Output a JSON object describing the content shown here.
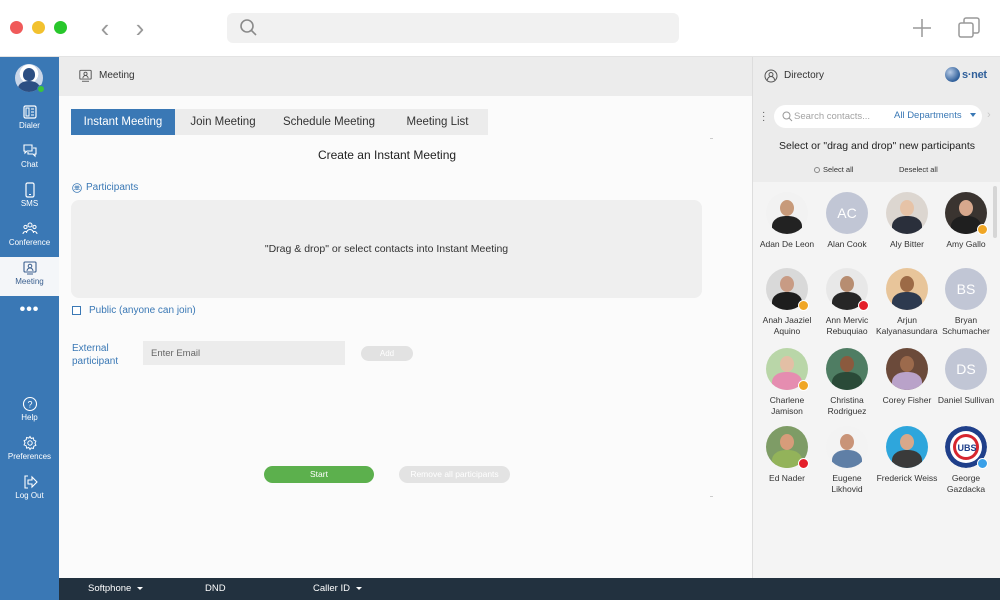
{
  "window": {
    "back_icon": "chevron-left-icon",
    "forward_icon": "chevron-right-icon",
    "search_icon": "search-icon",
    "new_tab_icon": "plus-icon",
    "tabs_icon": "copy-windows-icon"
  },
  "sidebar": {
    "user_status": "online",
    "items": [
      {
        "label": "Dialer",
        "icon": "dialer-icon"
      },
      {
        "label": "Chat",
        "icon": "chat-icon"
      },
      {
        "label": "SMS",
        "icon": "phone-icon"
      },
      {
        "label": "Conference",
        "icon": "conference-icon"
      },
      {
        "label": "Meeting",
        "icon": "meeting-icon",
        "active": true
      }
    ],
    "more_label": "•••",
    "bottom_items": [
      {
        "label": "Help",
        "icon": "help-icon"
      },
      {
        "label": "Preferences",
        "icon": "gear-icon"
      },
      {
        "label": "Log Out",
        "icon": "logout-icon"
      }
    ]
  },
  "meeting": {
    "header_title": "Meeting",
    "tabs": [
      {
        "label": "Instant Meeting",
        "active": true
      },
      {
        "label": "Join Meeting"
      },
      {
        "label": "Schedule Meeting"
      },
      {
        "label": "Meeting List"
      }
    ],
    "section_title": "Create an Instant Meeting",
    "participants_label": "Participants",
    "dropzone_text": "\"Drag & drop\" or select contacts into Instant Meeting",
    "public_label": "Public (anyone can join)",
    "public_checked": false,
    "external_label_line1": "External",
    "external_label_line2": "participant",
    "email_placeholder": "Enter Email",
    "email_value": "",
    "add_label": "Add",
    "start_label": "Start",
    "remove_all_label": "Remove all participants"
  },
  "directory": {
    "header_title": "Directory",
    "logo_text": "s·net",
    "search_placeholder": "Search contacts...",
    "department": "All Departments",
    "prompt": "Select or \"drag and drop\" new participants",
    "select_all": "Select all",
    "deselect_all": "Deselect all",
    "contacts": [
      {
        "name": "Adan De Leon",
        "initials": "",
        "status": "",
        "bg": "#f2f2f2",
        "skin": "#c79a7a",
        "cloth": "#222222"
      },
      {
        "name": "Alan Cook",
        "initials": "AC",
        "status": ""
      },
      {
        "name": "Aly Bitter",
        "initials": "",
        "status": "",
        "bg": "#dcd6d0",
        "skin": "#e6c3a7",
        "cloth": "#2a2f3b"
      },
      {
        "name": "Amy Gallo",
        "initials": "",
        "status": "away",
        "bg": "#3a3430",
        "skin": "#d7a88d",
        "cloth": "#1f1f1f"
      },
      {
        "name": "Anah Jaaziel Aquino",
        "initials": "",
        "status": "away",
        "bg": "#d9d9d9",
        "skin": "#c89b84",
        "cloth": "#1d1d1d"
      },
      {
        "name": "Ann Mervic Rebuquiao",
        "initials": "",
        "status": "dnd",
        "bg": "#e8e8e8",
        "skin": "#b78d71",
        "cloth": "#262626"
      },
      {
        "name": "Arjun Kalyanasundaram",
        "initials": "",
        "status": "",
        "bg": "#e8c59a",
        "skin": "#9c6a46",
        "cloth": "#2d3a4f"
      },
      {
        "name": "Bryan Schumacher",
        "initials": "BS",
        "status": ""
      },
      {
        "name": "Charlene Jamison",
        "initials": "",
        "status": "away",
        "bg": "#b9d6a8",
        "skin": "#e3bfa5",
        "cloth": "#e58db0"
      },
      {
        "name": "Christina Rodriguez",
        "initials": "",
        "status": "",
        "bg": "#4f7d63",
        "skin": "#8b5a3e",
        "cloth": "#2a4a38"
      },
      {
        "name": "Corey Fisher",
        "initials": "",
        "status": "",
        "bg": "#6b4a3a",
        "skin": "#9c6a4c",
        "cloth": "#b9a2c9"
      },
      {
        "name": "Daniel Sullivan",
        "initials": "DS",
        "status": ""
      },
      {
        "name": "Ed Nader",
        "initials": "",
        "status": "busy",
        "bg": "#7e9c66",
        "skin": "#d79c7a",
        "cloth": "#93b35a"
      },
      {
        "name": "Eugene Likhovid",
        "initials": "",
        "status": "",
        "bg": "#f3f3f3",
        "skin": "#c99478",
        "cloth": "#5f7fa6"
      },
      {
        "name": "Frederick Weiss",
        "initials": "",
        "status": "",
        "bg": "#2ea6dc",
        "skin": "#d8a88a",
        "cloth": "#3a3a3a"
      },
      {
        "name": "George Gazdacka",
        "initials": "",
        "status": "call",
        "logo": "cubs"
      }
    ]
  },
  "bottombar": {
    "softphone": "Softphone",
    "dnd": "DND",
    "caller_id": "Caller ID"
  }
}
